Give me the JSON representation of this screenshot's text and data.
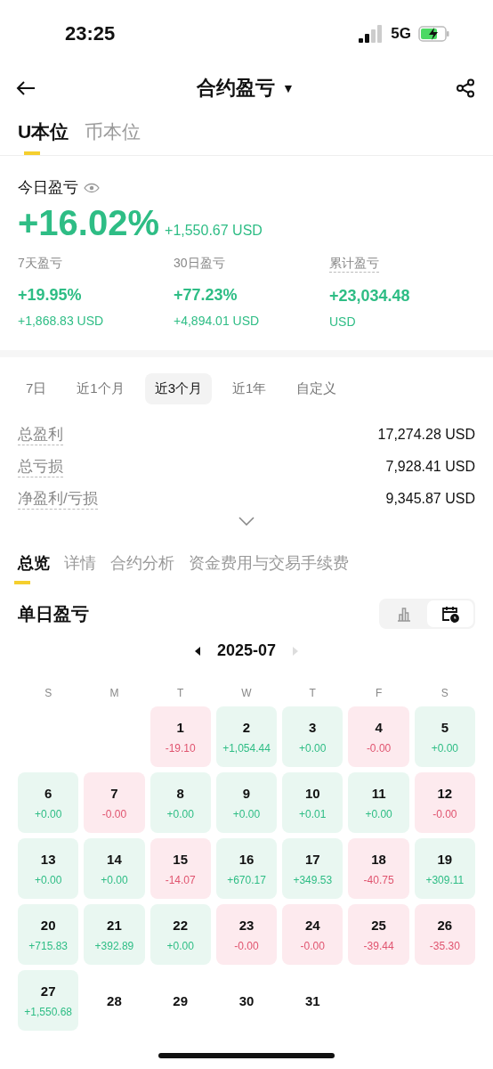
{
  "status_bar": {
    "time": "23:25",
    "network": "5G"
  },
  "header": {
    "title": "合约盈亏",
    "dropdown_mark": "▼"
  },
  "asset_tabs": [
    {
      "label": "U本位",
      "selected": true
    },
    {
      "label": "币本位",
      "selected": false
    }
  ],
  "today": {
    "label": "今日盈亏",
    "percent": "+16.02%",
    "amount": "+1,550.67 USD"
  },
  "periods_summary": [
    {
      "label": "7天盈亏",
      "percent": "+19.95%",
      "amount": "+1,868.83 USD",
      "dotted": false
    },
    {
      "label": "30日盈亏",
      "percent": "+77.23%",
      "amount": "+4,894.01 USD",
      "dotted": false
    },
    {
      "label": "累计盈亏",
      "percent": "+23,034.48",
      "amount": "USD",
      "dotted": true
    }
  ],
  "range_chips": [
    {
      "label": "7日",
      "selected": false
    },
    {
      "label": "近1个月",
      "selected": false
    },
    {
      "label": "近3个月",
      "selected": true
    },
    {
      "label": "近1年",
      "selected": false
    },
    {
      "label": "自定义",
      "selected": false
    }
  ],
  "totals": [
    {
      "label": "总盈利",
      "value": "17,274.28 USD"
    },
    {
      "label": "总亏损",
      "value": "7,928.41 USD"
    },
    {
      "label": "净盈利/亏损",
      "value": "9,345.87 USD"
    }
  ],
  "section_tabs": [
    {
      "label": "总览",
      "selected": true
    },
    {
      "label": "详情",
      "selected": false
    },
    {
      "label": "合约分析",
      "selected": false
    },
    {
      "label": "资金费用与交易手续费",
      "selected": false
    }
  ],
  "daily": {
    "title": "单日盈亏",
    "views": [
      {
        "kind": "chart",
        "selected": false
      },
      {
        "kind": "calendar",
        "selected": true
      }
    ],
    "month": "2025-07",
    "weekdays": [
      "S",
      "M",
      "T",
      "W",
      "T",
      "F",
      "S"
    ],
    "days": [
      {
        "kind": "blank"
      },
      {
        "kind": "blank"
      },
      {
        "kind": "loss",
        "day": "1",
        "pnl": "-19.10"
      },
      {
        "kind": "gain",
        "day": "2",
        "pnl": "+1,054.44"
      },
      {
        "kind": "gain",
        "day": "3",
        "pnl": "+0.00"
      },
      {
        "kind": "loss",
        "day": "4",
        "pnl": "-0.00"
      },
      {
        "kind": "gain",
        "day": "5",
        "pnl": "+0.00"
      },
      {
        "kind": "gain",
        "day": "6",
        "pnl": "+0.00"
      },
      {
        "kind": "loss",
        "day": "7",
        "pnl": "-0.00"
      },
      {
        "kind": "gain",
        "day": "8",
        "pnl": "+0.00"
      },
      {
        "kind": "gain",
        "day": "9",
        "pnl": "+0.00"
      },
      {
        "kind": "gain",
        "day": "10",
        "pnl": "+0.01"
      },
      {
        "kind": "gain",
        "day": "11",
        "pnl": "+0.00"
      },
      {
        "kind": "loss",
        "day": "12",
        "pnl": "-0.00"
      },
      {
        "kind": "gain",
        "day": "13",
        "pnl": "+0.00"
      },
      {
        "kind": "gain",
        "day": "14",
        "pnl": "+0.00"
      },
      {
        "kind": "loss",
        "day": "15",
        "pnl": "-14.07"
      },
      {
        "kind": "gain",
        "day": "16",
        "pnl": "+670.17"
      },
      {
        "kind": "gain",
        "day": "17",
        "pnl": "+349.53"
      },
      {
        "kind": "loss",
        "day": "18",
        "pnl": "-40.75"
      },
      {
        "kind": "gain",
        "day": "19",
        "pnl": "+309.11"
      },
      {
        "kind": "gain",
        "day": "20",
        "pnl": "+715.83"
      },
      {
        "kind": "gain",
        "day": "21",
        "pnl": "+392.89"
      },
      {
        "kind": "gain",
        "day": "22",
        "pnl": "+0.00"
      },
      {
        "kind": "loss",
        "day": "23",
        "pnl": "-0.00"
      },
      {
        "kind": "loss",
        "day": "24",
        "pnl": "-0.00"
      },
      {
        "kind": "loss",
        "day": "25",
        "pnl": "-39.44"
      },
      {
        "kind": "loss",
        "day": "26",
        "pnl": "-35.30"
      },
      {
        "kind": "gain",
        "day": "27",
        "pnl": "+1,550.68"
      },
      {
        "kind": "future",
        "day": "28"
      },
      {
        "kind": "future",
        "day": "29"
      },
      {
        "kind": "future",
        "day": "30"
      },
      {
        "kind": "future",
        "day": "31"
      }
    ]
  }
}
